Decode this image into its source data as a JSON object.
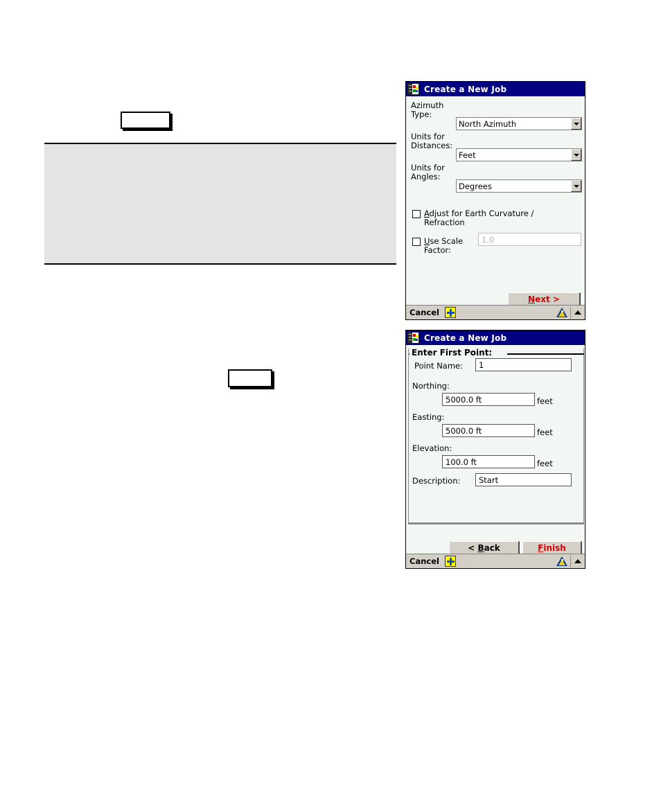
{
  "document": {
    "callout_box_1": "",
    "callout_box_2": "",
    "shaded_panel_text": ""
  },
  "windows": [
    {
      "id": "create-job-settings",
      "title": "Create a New Job",
      "title_icon": "job-book-icon",
      "fields": [
        {
          "label_line1": "Azimuth",
          "label_line2": "Type:",
          "value": "North Azimuth"
        },
        {
          "label_line1": "Units for",
          "label_line2": "Distances:",
          "value": "Feet"
        },
        {
          "label_line1": "Units for",
          "label_line2": "Angles:",
          "value": "Degrees"
        }
      ],
      "checkboxes": [
        {
          "accel": "A",
          "label_rest": "djust for Earth Curvature /",
          "label_line2": "Refraction",
          "checked": false
        },
        {
          "accel": "U",
          "label_rest": "se Scale",
          "label_line2": "Factor:",
          "checked": false
        }
      ],
      "scale_factor_value": "1.0",
      "buttons": [
        {
          "accel": "N",
          "prefix": "",
          "rest": "ext >",
          "color": "#d00000"
        }
      ],
      "statusbar": {
        "cancel_label": "Cancel",
        "start_icon": "start-asterisk-icon",
        "app_icon": "carlson-triangle-icon",
        "up_arrow_icon": "chevron-up-icon"
      }
    },
    {
      "id": "create-job-firstpoint",
      "title": "Create a New Job",
      "title_icon": "job-book-icon",
      "groupbox_title": "Enter First Point:",
      "rows": [
        {
          "label": "Point Name:",
          "value": "1",
          "unit": "",
          "layout": "inline"
        },
        {
          "label": "Northing:",
          "value": "5000.0 ft",
          "unit": "feet",
          "layout": "stacked"
        },
        {
          "label": "Easting:",
          "value": "5000.0 ft",
          "unit": "feet",
          "layout": "stacked"
        },
        {
          "label": "Elevation:",
          "value": "100.0 ft",
          "unit": "feet",
          "layout": "stacked"
        },
        {
          "label": "Description:",
          "value": "Start",
          "unit": "",
          "layout": "inline"
        }
      ],
      "buttons": [
        {
          "accel": "B",
          "prefix": "< ",
          "rest": "ack",
          "color": "#000000"
        },
        {
          "accel": "F",
          "prefix": "",
          "rest": "inish",
          "color": "#d00000"
        }
      ],
      "statusbar": {
        "cancel_label": "Cancel",
        "start_icon": "start-asterisk-icon",
        "app_icon": "carlson-triangle-icon",
        "up_arrow_icon": "chevron-up-icon"
      }
    }
  ]
}
